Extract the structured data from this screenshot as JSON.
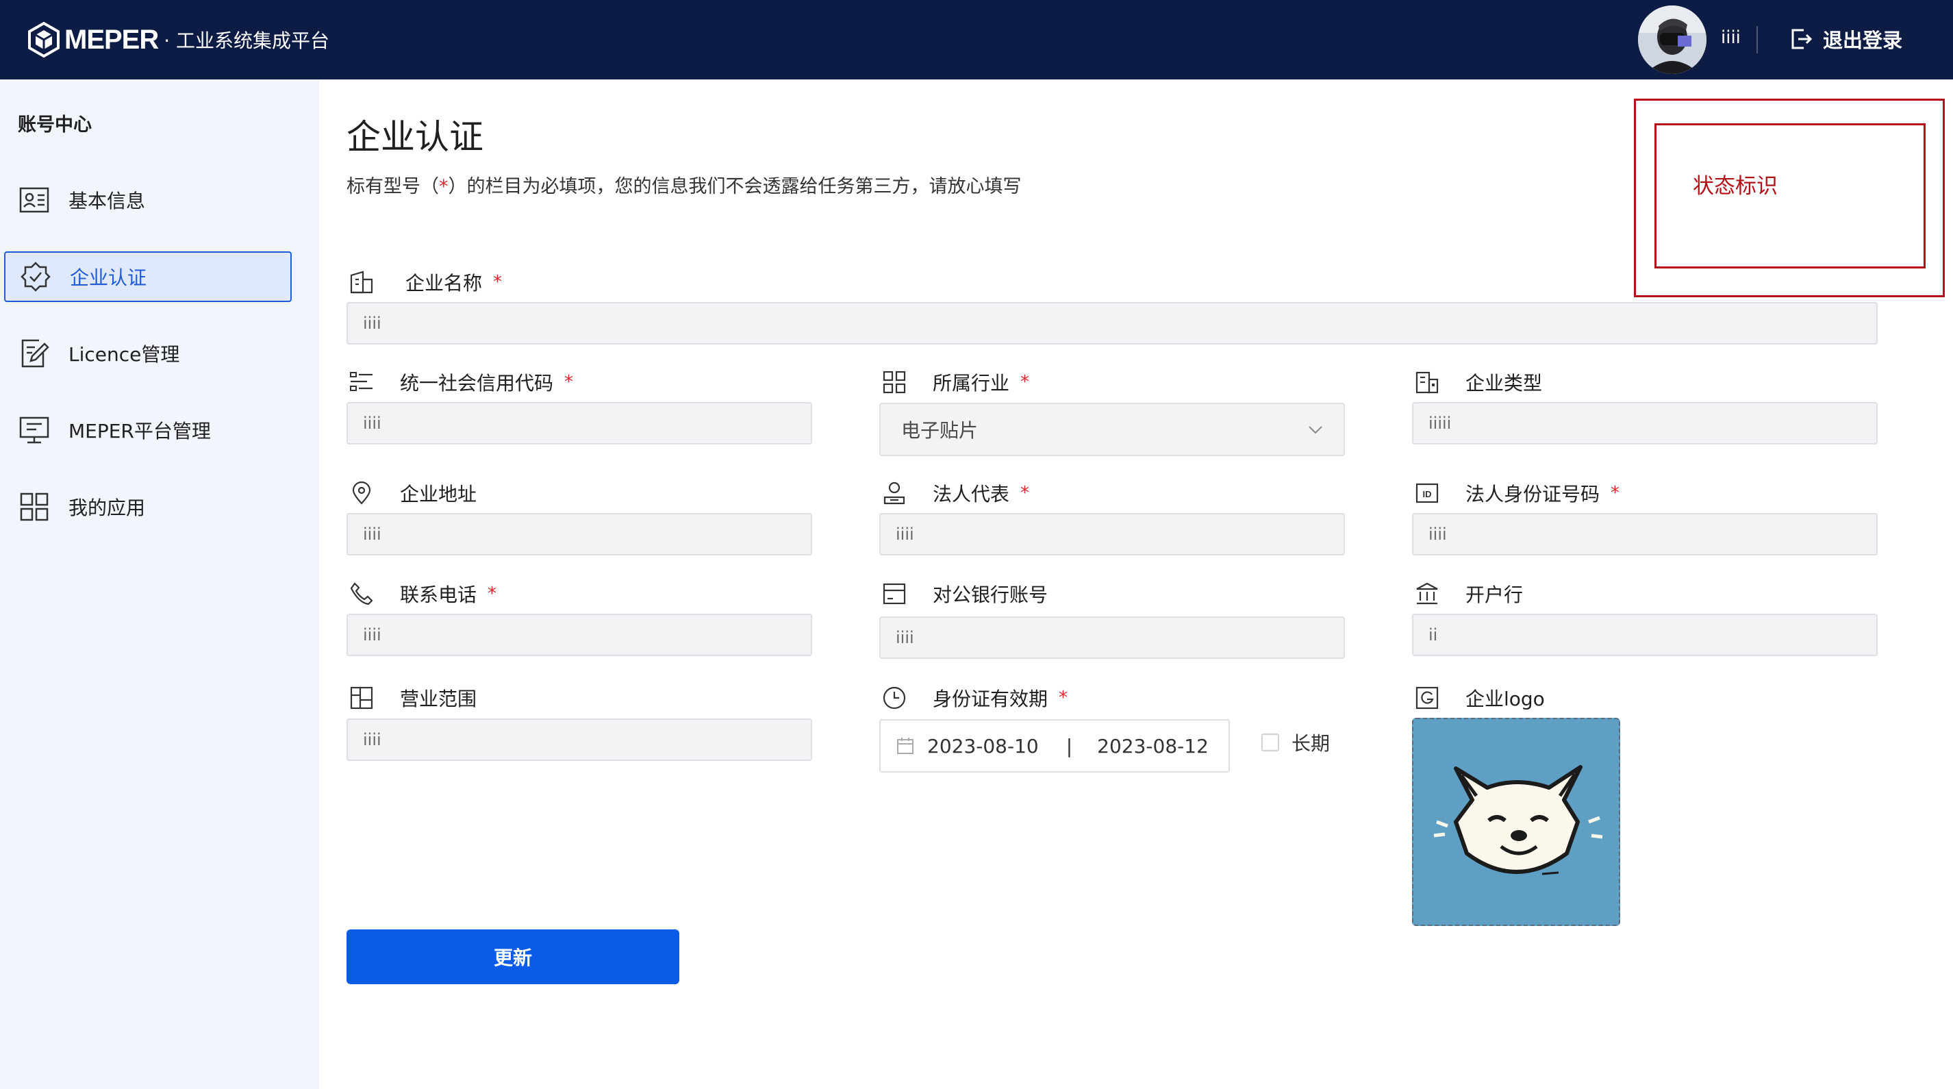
{
  "header": {
    "brand": "MEPER",
    "subtitle": "· 工业系统集成平台",
    "username": "iiii",
    "logout_label": "退出登录"
  },
  "sidebar": {
    "title": "账号中心",
    "items": [
      {
        "label": "基本信息",
        "icon": "id-card-icon"
      },
      {
        "label": "企业认证",
        "icon": "badge-check-icon",
        "active": true
      },
      {
        "label": "Licence管理",
        "icon": "edit-document-icon"
      },
      {
        "label": "MEPER平台管理",
        "icon": "monitor-icon"
      },
      {
        "label": "我的应用",
        "icon": "apps-grid-icon"
      }
    ]
  },
  "main": {
    "title": "企业认证",
    "notice_pre": "标有型号（",
    "notice_star": "*",
    "notice_post": "）的栏目为必填项，您的信息我们不会透露给任务第三方，请放心填写",
    "annotation": "状态标识",
    "required_mark": "*",
    "fields": {
      "company_name": {
        "label": "企业名称",
        "value": "iiii"
      },
      "credit_code": {
        "label": "统一社会信用代码",
        "value": "iiii"
      },
      "industry": {
        "label": "所属行业",
        "value": "电子贴片"
      },
      "company_type": {
        "label": "企业类型",
        "value": "iiiii"
      },
      "address": {
        "label": "企业地址",
        "value": "iiii"
      },
      "legal_rep": {
        "label": "法人代表",
        "value": "iiii"
      },
      "legal_id": {
        "label": "法人身份证号码",
        "value": "iiii"
      },
      "phone": {
        "label": "联系电话",
        "value": "iiii"
      },
      "bank_account": {
        "label": "对公银行账号",
        "value": "iiii"
      },
      "bank": {
        "label": "开户行",
        "value": "ii"
      },
      "scope": {
        "label": "营业范围",
        "value": "iiii"
      },
      "id_validity": {
        "label": "身份证有效期",
        "start": "2023-08-10",
        "separator": "|",
        "end": "2023-08-12",
        "long_term_label": "长期"
      },
      "logo": {
        "label": "企业logo"
      }
    },
    "update_button": "更新"
  },
  "colors": {
    "topbar": "#0c1c45",
    "accent": "#0a5ce8",
    "required": "#e0262c",
    "annotation": "#b3121a"
  }
}
